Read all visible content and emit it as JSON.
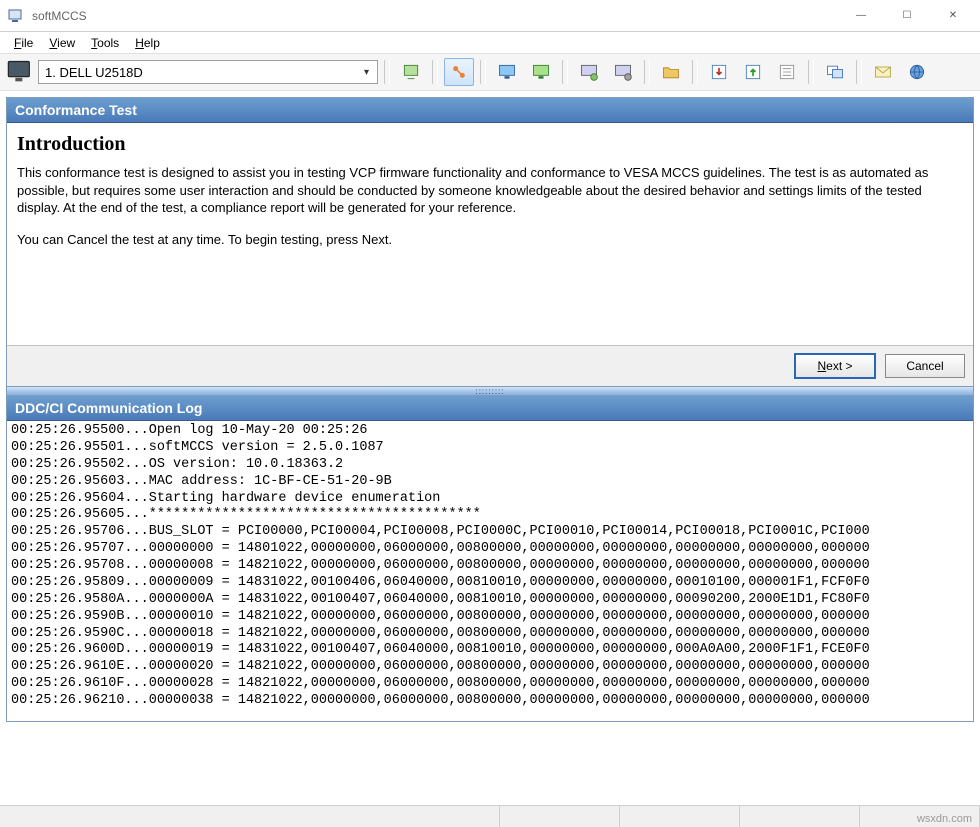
{
  "window": {
    "title": "softMCCS",
    "controls": {
      "min": "—",
      "max": "☐",
      "close": "✕"
    }
  },
  "menu": {
    "items": [
      {
        "label": "File",
        "mn": "F"
      },
      {
        "label": "View",
        "mn": "V"
      },
      {
        "label": "Tools",
        "mn": "T"
      },
      {
        "label": "Help",
        "mn": "H"
      }
    ]
  },
  "toolbar": {
    "selected_display": "1. DELL U2518D",
    "icons": [
      "refresh-icon",
      "link-icon",
      "monitor-blue-icon",
      "monitor-green-icon",
      "settings1-icon",
      "settings2-icon",
      "folder-icon",
      "import-icon",
      "export-icon",
      "list-icon",
      "window-icon",
      "mail-icon",
      "globe-icon"
    ],
    "active_index": 1
  },
  "conformance": {
    "title": "Conformance Test",
    "heading": "Introduction",
    "para1": "This conformance test is designed to assist you in testing VCP firmware functionality and conformance to VESA MCCS guidelines. The test is as automated as possible, but requires some user interaction and should be conducted by someone knowledgeable about the desired behavior and settings limits of the tested display. At the end of the test, a compliance report will be generated for your reference.",
    "para2": "You can Cancel the test at any time. To begin testing, press Next.",
    "buttons": {
      "next": "Next >",
      "cancel": "Cancel"
    }
  },
  "log": {
    "title": "DDC/CI Communication Log",
    "lines": [
      "00:25:26.95500...Open log 10-May-20 00:25:26",
      "00:25:26.95501...softMCCS version = 2.5.0.1087",
      "00:25:26.95502...OS version: 10.0.18363.2",
      "00:25:26.95603...MAC address: 1C-BF-CE-51-20-9B",
      "00:25:26.95604...Starting hardware device enumeration",
      "00:25:26.95605...*****************************************",
      "00:25:26.95706...BUS_SLOT = PCI00000,PCI00004,PCI00008,PCI0000C,PCI00010,PCI00014,PCI00018,PCI0001C,PCI000",
      "00:25:26.95707...00000000 = 14801022,00000000,06000000,00800000,00000000,00000000,00000000,00000000,000000",
      "00:25:26.95708...00000008 = 14821022,00000000,06000000,00800000,00000000,00000000,00000000,00000000,000000",
      "00:25:26.95809...00000009 = 14831022,00100406,06040000,00810010,00000000,00000000,00010100,000001F1,FCF0F0",
      "00:25:26.9580A...0000000A = 14831022,00100407,06040000,00810010,00000000,00000000,00090200,2000E1D1,FC80F0",
      "00:25:26.9590B...00000010 = 14821022,00000000,06000000,00800000,00000000,00000000,00000000,00000000,000000",
      "00:25:26.9590C...00000018 = 14821022,00000000,06000000,00800000,00000000,00000000,00000000,00000000,000000",
      "00:25:26.9600D...00000019 = 14831022,00100407,06040000,00810010,00000000,00000000,000A0A00,2000F1F1,FCE0F0",
      "00:25:26.9610E...00000020 = 14821022,00000000,06000000,00800000,00000000,00000000,00000000,00000000,000000",
      "00:25:26.9610F...00000028 = 14821022,00000000,06000000,00800000,00000000,00000000,00000000,00000000,000000",
      "00:25:26.96210...00000038 = 14821022,00000000,06000000,00800000,00000000,00000000,00000000,00000000,000000"
    ]
  },
  "watermark": "wsxdn.com"
}
